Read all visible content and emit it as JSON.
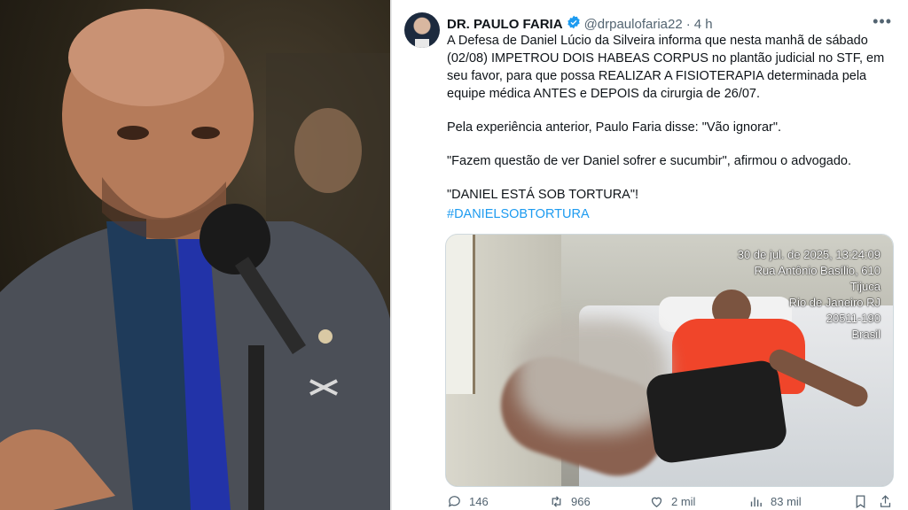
{
  "tweet": {
    "display_name": "DR. PAULO FARIA",
    "handle": "@drpaulofaria22",
    "separator": "·",
    "time": "4 h",
    "more_icon": "more-icon",
    "paragraphs": [
      "A Defesa de Daniel Lúcio da Silveira informa que nesta manhã de sábado (02/08) IMPETROU DOIS HABEAS CORPUS no plantão judicial no STF, em seu favor, para que possa REALIZAR A FISIOTERAPIA determinada pela equipe médica ANTES e DEPOIS da cirurgia de 26/07.",
      "Pela experiência anterior, Paulo Faria disse: \"Vão ignorar\".",
      "\"Fazem questão de ver Daniel sofrer e sucumbir\", afirmou o advogado.",
      "\"DANIEL ESTÁ SOB TORTURA\"!"
    ],
    "hashtag": "#DANIELSOBTORTURA",
    "media_stamp": [
      "30 de jul. de 2025, 13:24:09",
      "Rua Antônio Basílio, 610",
      "Tijuca",
      "Rio de Janeiro RJ",
      "20511-190",
      "Brasil"
    ],
    "actions": {
      "replies": "146",
      "retweets": "966",
      "likes": "2 mil",
      "views": "83 mil"
    },
    "accent_color": "#1d9bf0"
  }
}
